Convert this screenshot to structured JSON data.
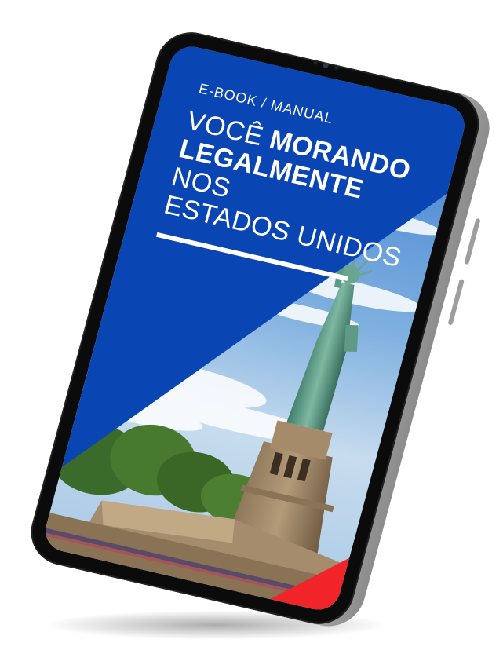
{
  "cover": {
    "kicker": "E-BOOK / MANUAL",
    "headline": {
      "word1": "VOCÊ",
      "word2": "MORANDO",
      "word3": "LEGALMENTE",
      "word4": "NOS",
      "line3": "ESTADOS UNIDOS"
    }
  },
  "colors": {
    "brand_blue": "#0a45b4",
    "accent_red": "#f1242a",
    "statue_green": "#5f9a86",
    "tablet_frame": "#0b0b0b"
  },
  "icons": {
    "camera": "camera-lens-icon"
  }
}
